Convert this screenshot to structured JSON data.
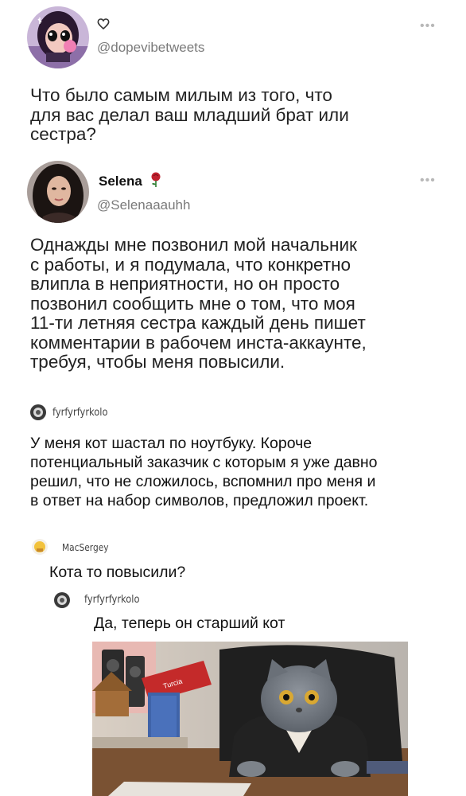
{
  "tweet1": {
    "icon": "heart-outline-icon",
    "handle": "@dopevibetweets",
    "text": [
      "Что было самым милым из того, что",
      "для вас делал ваш младший брат или",
      "сестра?"
    ]
  },
  "tweet2": {
    "name": "Selena",
    "name_icon": "rose-emoji-icon",
    "handle": "@Selenaaauhh",
    "text": [
      "Однажды мне позвонил мой начальник",
      "с работы, и я подумала, что конкретно",
      "влипла в неприятности, но он просто",
      "позвонил сообщить мне о том, что моя",
      "11-ти летняя сестра каждый день пишет",
      "комментарии в рабочем инста-аккаунте,",
      "требуя, чтобы меня повысили."
    ]
  },
  "comments": [
    {
      "user": "fyrfyrfyrkolo",
      "text": [
        "У меня кот шастал по ноутбуку. Короче",
        "потенциальный заказчик с которым я уже давно",
        "решил, что не сложилось, вспомнил про меня и",
        "в ответ на набор символов, предложил проект."
      ]
    },
    {
      "user": "MacSergey",
      "text": [
        "Кота то повысили?"
      ]
    },
    {
      "user": "fyrfyrfyrkolo",
      "text": [
        "Да, теперь он старший кот"
      ]
    }
  ],
  "photo": {
    "sign_text": "Turcia"
  }
}
